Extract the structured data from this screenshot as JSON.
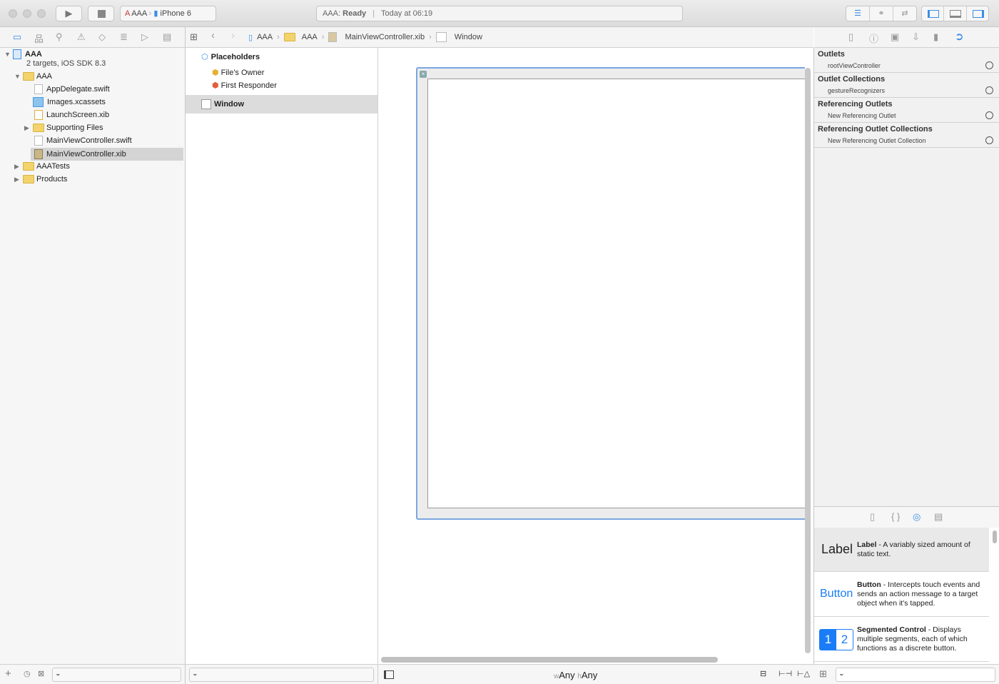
{
  "toolbar": {
    "scheme": "AAA",
    "device": "iPhone 6",
    "status_prefix": "AAA:",
    "status_state": "Ready",
    "status_time": "Today at 06:19"
  },
  "jumpbar": [
    "AAA",
    "AAA",
    "MainViewController.xib",
    "Window"
  ],
  "navigator": {
    "project": "AAA",
    "project_sub": "2 targets, iOS SDK 8.3",
    "items": [
      "AAA",
      "AppDelegate.swift",
      "Images.xcassets",
      "LaunchScreen.xib",
      "Supporting Files",
      "MainViewController.swift",
      "MainViewController.xib",
      "AAATests",
      "Products"
    ],
    "selected": "MainViewController.xib"
  },
  "outline": {
    "placeholders": "Placeholders",
    "files_owner": "File's Owner",
    "first_responder": "First Responder",
    "window": "Window"
  },
  "canvas": {
    "size_w_prefix": "w",
    "size_w": "Any",
    "size_h_prefix": "h",
    "size_h": "Any"
  },
  "inspector": {
    "sections": [
      {
        "title": "Outlets",
        "item": "rootViewController"
      },
      {
        "title": "Outlet Collections",
        "item": "gestureRecognizers"
      },
      {
        "title": "Referencing Outlets",
        "item": "New Referencing Outlet"
      },
      {
        "title": "Referencing Outlet Collections",
        "item": "New Referencing Outlet Collection"
      }
    ]
  },
  "library": [
    {
      "preview": "Label",
      "name": "Label",
      "desc": " - A variably sized amount of static text."
    },
    {
      "preview": "Button",
      "name": "Button",
      "desc": " - Intercepts touch events and sends an action message to a target object when it's tapped."
    },
    {
      "preview_1": "1",
      "preview_2": "2",
      "name": "Segmented Control",
      "desc": " - Displays multiple segments, each of which functions as a discrete button."
    }
  ],
  "colors": {
    "accent": "#1a7cf7",
    "selection": "#d4d4d4",
    "canvas_border": "#7aa7e0"
  }
}
